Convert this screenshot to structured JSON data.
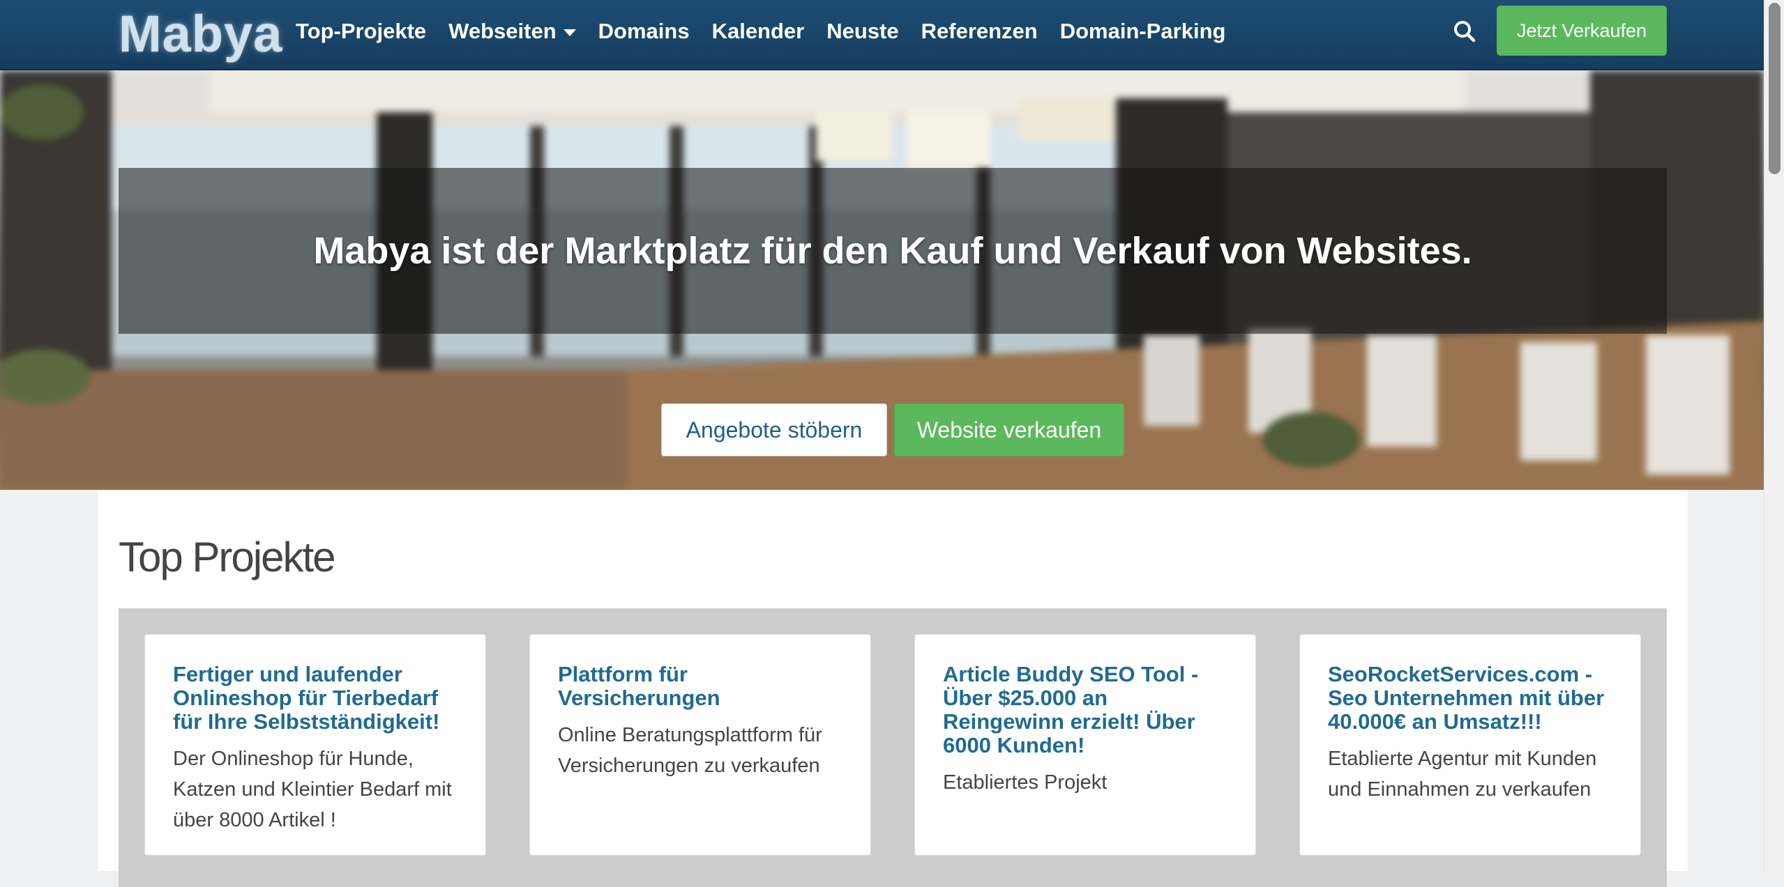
{
  "nav": {
    "logo": "Mabya",
    "links": [
      "Top-Projekte",
      "Webseiten",
      "Domains",
      "Kalender",
      "Neuste",
      "Referenzen",
      "Domain-Parking"
    ],
    "sell_button": "Jetzt Verkaufen"
  },
  "hero": {
    "title": "Mabya ist der Marktplatz für den Kauf und Verkauf von Websites.",
    "browse_button": "Angebote stöbern",
    "sell_site_button": "Website verkaufen"
  },
  "top_projects": {
    "heading": "Top Projekte",
    "cards": [
      {
        "title": "Fertiger und laufender Onlineshop für Tierbedarf für Ihre Selbstständigkeit!",
        "description": "Der Onlineshop für Hunde, Katzen und Kleintier Bedarf mit über 8000 Artikel !"
      },
      {
        "title": "Plattform für Versicherungen",
        "description": "Online Beratungsplattform für Versicherungen zu verkaufen"
      },
      {
        "title": "Article Buddy SEO Tool - Über $25.000 an Reingewinn erzielt! Über 6000 Kunden!",
        "description": "Etabliertes Projekt"
      },
      {
        "title": "SeoRocketServices.com - Seo Unternehmen mit über 40.000€ an Umsatz!!!",
        "description": "Etablierte Agentur mit Kunden und Einnahmen zu verkaufen"
      }
    ]
  },
  "colors": {
    "navbar": "#1d4d73",
    "accent_green": "#5cb85c",
    "link_blue": "#1f6a93"
  }
}
